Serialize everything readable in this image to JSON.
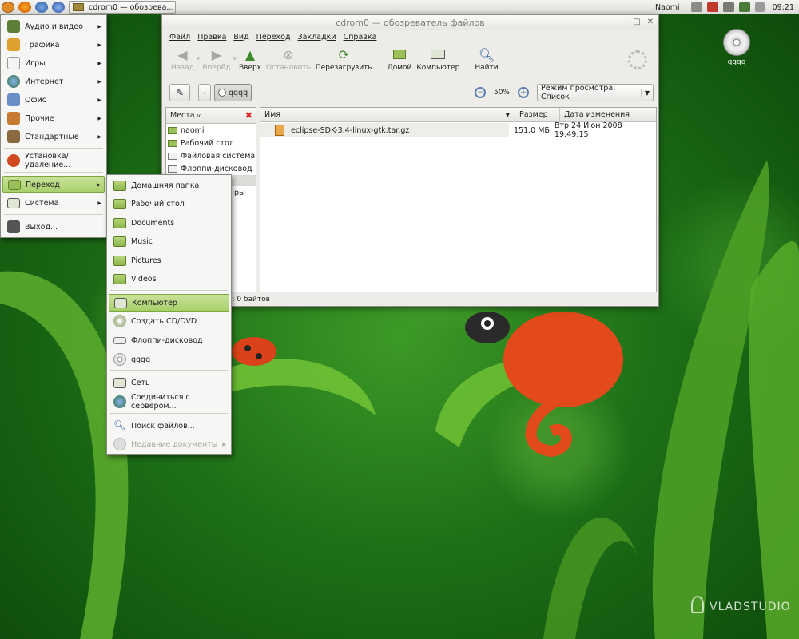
{
  "top_panel": {
    "task_button": "cdrom0 — обозрева...",
    "user": "Naomi",
    "clock": "09:21",
    "launchers": [
      "ubuntu-logo-icon",
      "firefox-icon",
      "thunderbird-icon",
      "globe-icon"
    ],
    "tray_icons": [
      "home-icon",
      "update-icon",
      "network-icon",
      "display-icon",
      "volume-icon"
    ]
  },
  "desktop": {
    "cd_label": "qqqq",
    "watermark": "VLADSTUDIO"
  },
  "window": {
    "title": "cdrom0 — обозреватель файлов",
    "menu": [
      "Файл",
      "Правка",
      "Вид",
      "Переход",
      "Закладки",
      "Справка"
    ],
    "toolbar": {
      "back": "Назад",
      "forward": "Вперёд",
      "up": "Вверх",
      "stop": "Остановить",
      "reload": "Перезагрузить",
      "home": "Домой",
      "computer": "Компьютер",
      "search": "Найти"
    },
    "path_button": "qqqq",
    "zoom_level": "50%",
    "view_mode": "Режим просмотра: Список",
    "sidebar_title": "Места",
    "sidebar_items": [
      "naomi",
      "Рабочий стол",
      "Файловая система",
      "Флоппи-дисковод"
    ],
    "sidebar_partial": "ры",
    "columns": [
      "Имя",
      "Размер",
      "Дата изменения"
    ],
    "files": [
      {
        "name": "eclipse-SDK-3.4-linux-gtk.tar.gz",
        "size": "151,0 МБ",
        "modified": "Втр 24 Июн 2008 19:49:15"
      }
    ],
    "status": "о: 0 байтов"
  },
  "apps_menu": [
    {
      "label": "Аудио и видео",
      "icon": "multimedia-icon",
      "submenu": true
    },
    {
      "label": "Графика",
      "icon": "graphics-icon",
      "submenu": true
    },
    {
      "label": "Игры",
      "icon": "games-icon",
      "submenu": true
    },
    {
      "label": "Интернет",
      "icon": "internet-icon",
      "submenu": true
    },
    {
      "label": "Офис",
      "icon": "office-icon",
      "submenu": true
    },
    {
      "label": "Прочие",
      "icon": "other-icon",
      "submenu": true
    },
    {
      "label": "Стандартные",
      "icon": "accessories-icon",
      "submenu": true
    },
    {
      "label": "Установка/удаление...",
      "icon": "add-remove-icon",
      "submenu": false
    },
    {
      "label": "Переход",
      "icon": "folder-icon",
      "submenu": true
    },
    {
      "label": "Система",
      "icon": "system-icon",
      "submenu": true
    },
    {
      "label": "Выход...",
      "icon": "logout-icon",
      "submenu": false
    }
  ],
  "places_menu": [
    {
      "label": "Домашняя папка",
      "icon": "home-folder-icon"
    },
    {
      "label": "Рабочий стол",
      "icon": "desktop-folder-icon"
    },
    {
      "label": "Documents",
      "icon": "folder-icon"
    },
    {
      "label": "Music",
      "icon": "folder-icon"
    },
    {
      "label": "Pictures",
      "icon": "folder-icon"
    },
    {
      "label": "Videos",
      "icon": "folder-icon"
    },
    {
      "label": "Компьютер",
      "icon": "computer-icon"
    },
    {
      "label": "Создать CD/DVD",
      "icon": "cd-burner-icon"
    },
    {
      "label": "Флоппи-дисковод",
      "icon": "floppy-icon"
    },
    {
      "label": "qqqq",
      "icon": "cdrom-icon"
    },
    {
      "label": "Сеть",
      "icon": "network-icon"
    },
    {
      "label": "Соединиться с сервером...",
      "icon": "connect-server-icon"
    },
    {
      "label": "Поиск файлов...",
      "icon": "search-icon"
    },
    {
      "label": "Недавние документы",
      "icon": "recent-icon"
    }
  ],
  "colors": {
    "menu_highlight": "#a8cf6a",
    "folder_green": "#9bc05a",
    "wallpaper_green": "#1e7018"
  }
}
